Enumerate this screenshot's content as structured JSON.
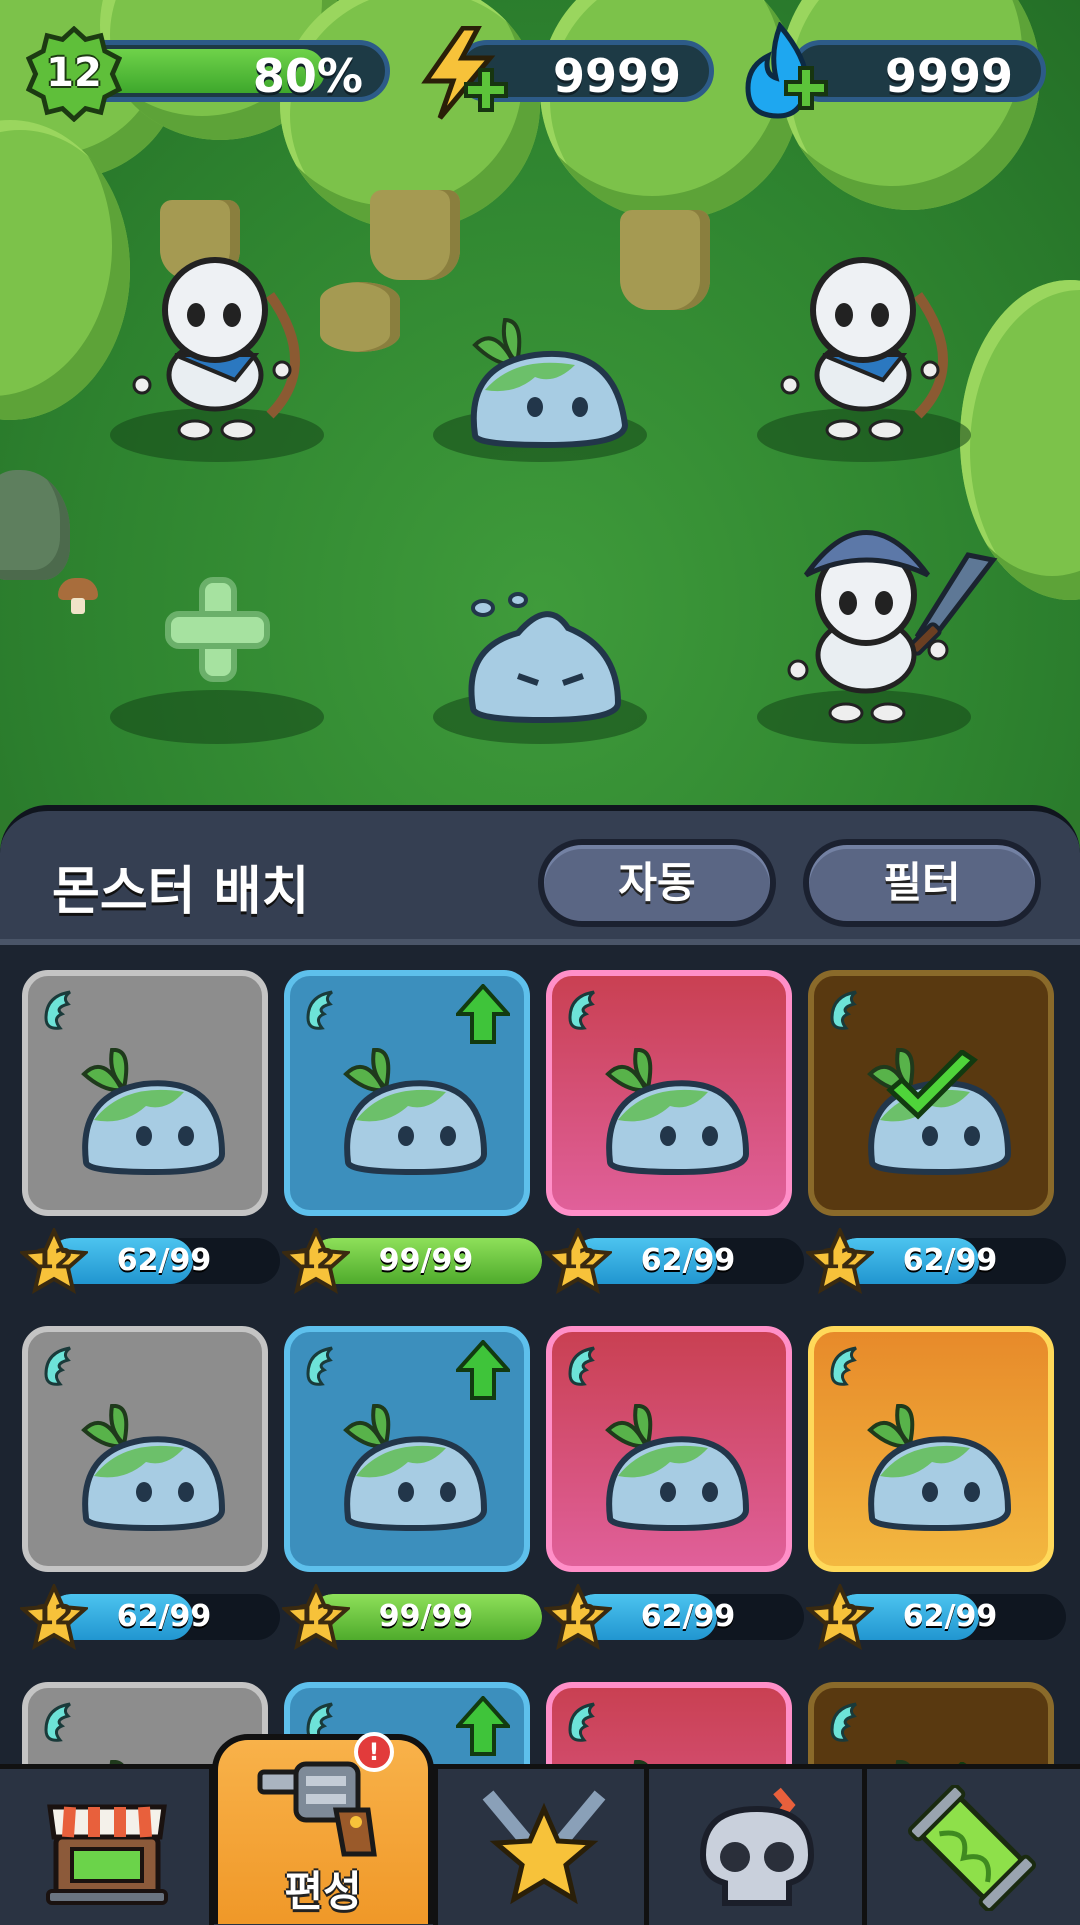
{
  "hud": {
    "player_level": "12",
    "exp_percent_label": "80%",
    "exp_percent": 80,
    "energy_value": "9999",
    "energy_icon": "lightning-plus-icon",
    "mana_value": "9999",
    "mana_icon": "blue-flame-plus-icon"
  },
  "battlefield": {
    "slots": [
      {
        "occupant": "skeleton-archer"
      },
      {
        "occupant": "leaf-slime"
      },
      {
        "occupant": "skeleton-archer"
      },
      {
        "occupant": "empty-add-slot"
      },
      {
        "occupant": "water-slime"
      },
      {
        "occupant": "skeleton-swordsman"
      }
    ]
  },
  "panel": {
    "title": "몬스터 배치",
    "auto_button": "자동",
    "filter_button": "필터"
  },
  "monster_cards": [
    {
      "rarity": "gray",
      "level": "12",
      "progress_label": "62/99",
      "progress": 62,
      "bar": "b",
      "upgrade": false,
      "selected": false
    },
    {
      "rarity": "blue",
      "level": "12",
      "progress_label": "99/99",
      "progress": 99,
      "bar": "g",
      "upgrade": true,
      "selected": false
    },
    {
      "rarity": "pink",
      "level": "12",
      "progress_label": "62/99",
      "progress": 62,
      "bar": "b",
      "upgrade": false,
      "selected": false
    },
    {
      "rarity": "gold",
      "level": "12",
      "progress_label": "62/99",
      "progress": 62,
      "bar": "b",
      "upgrade": false,
      "selected": true
    },
    {
      "rarity": "gray",
      "level": "12",
      "progress_label": "62/99",
      "progress": 62,
      "bar": "b",
      "upgrade": false,
      "selected": false
    },
    {
      "rarity": "blue",
      "level": "12",
      "progress_label": "99/99",
      "progress": 99,
      "bar": "g",
      "upgrade": true,
      "selected": false
    },
    {
      "rarity": "pink",
      "level": "12",
      "progress_label": "62/99",
      "progress": 62,
      "bar": "b",
      "upgrade": false,
      "selected": false
    },
    {
      "rarity": "gold",
      "level": "12",
      "progress_label": "62/99",
      "progress": 62,
      "bar": "b",
      "upgrade": false,
      "selected": false
    },
    {
      "rarity": "gray",
      "upgrade": false,
      "selected": false
    },
    {
      "rarity": "blue",
      "upgrade": true,
      "selected": false
    },
    {
      "rarity": "pink",
      "upgrade": false,
      "selected": false
    },
    {
      "rarity": "gold",
      "upgrade": false,
      "selected": true
    }
  ],
  "nav": {
    "shop_icon": "shop-stall-icon",
    "formation_label": "편성",
    "formation_icon": "revolver-icon",
    "formation_alert": "!",
    "battle_icon": "crossed-swords-star-icon",
    "boss_icon": "skull-icon",
    "gene_icon": "dna-capsule-icon"
  },
  "colors": {
    "panel_bg": "#1c2430",
    "panel_header": "#353f52",
    "active_tab": "#f5a637",
    "exp_bar": "#4fb432",
    "progress_blue": "#2ea3da",
    "progress_green": "#5cbf35"
  }
}
